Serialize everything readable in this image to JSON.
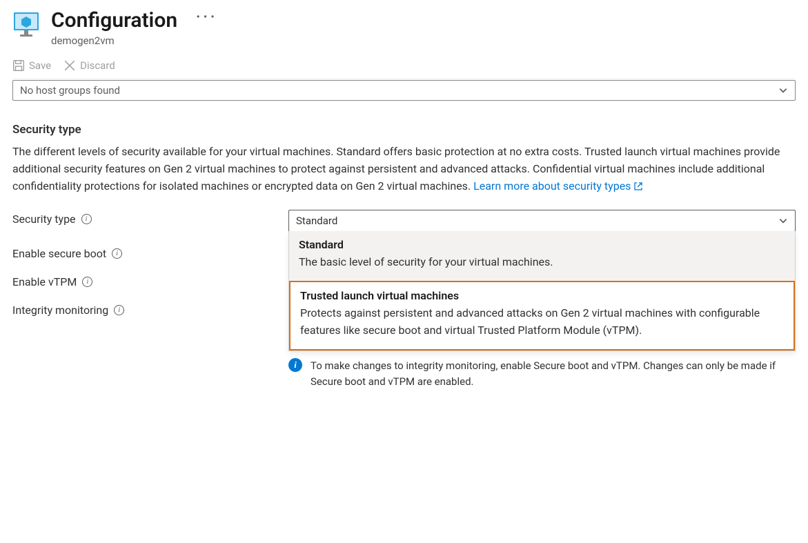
{
  "header": {
    "title": "Configuration",
    "subtitle": "demogen2vm"
  },
  "toolbar": {
    "save_label": "Save",
    "discard_label": "Discard"
  },
  "host_group_select": {
    "placeholder": "No host groups found"
  },
  "security": {
    "heading": "Security type",
    "description": "The different levels of security available for your virtual machines. Standard offers basic protection at no extra costs. Trusted launch virtual machines provide additional security features on Gen 2 virtual machines to protect against persistent and advanced attacks. Confidential virtual machines include additional confidentiality protections for isolated machines or encrypted data on Gen 2 virtual machines. ",
    "learn_more": "Learn more about security types",
    "field_label": "Security type",
    "selected_value": "Standard",
    "options": [
      {
        "title": "Standard",
        "desc": "The basic level of security for your virtual machines."
      },
      {
        "title": "Trusted launch virtual machines",
        "desc": "Protects against persistent and advanced attacks on Gen 2 virtual machines with configurable features like secure boot and virtual Trusted Platform Module (vTPM)."
      }
    ]
  },
  "fields": {
    "secure_boot": "Enable secure boot",
    "vtpm": "Enable vTPM",
    "integrity": "Integrity monitoring"
  },
  "integrity_info": "To make changes to integrity monitoring, enable Secure boot and vTPM. Changes can only be made if Secure boot and vTPM are enabled."
}
